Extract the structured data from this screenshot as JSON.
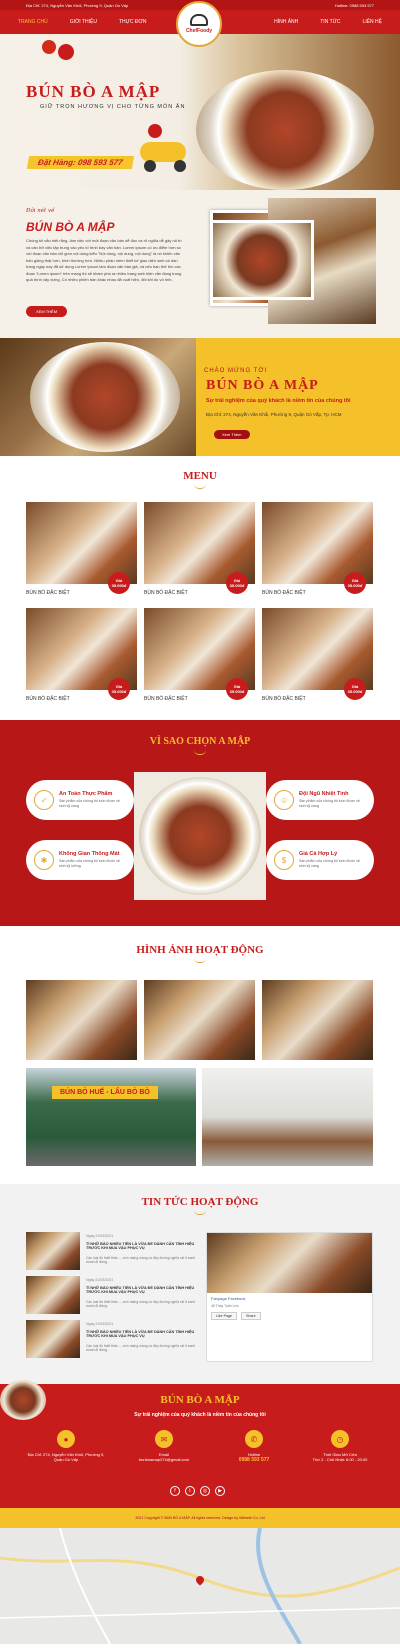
{
  "topbar": {
    "address": "Địa Chỉ: 274, Nguyễn Văn Khối, Phường 9, Quận Gò Vấp",
    "hotline": "Hotline: 0988 593 577"
  },
  "nav": {
    "items": [
      "TRANG CHỦ",
      "GIỚI THIỆU",
      "THỰC ĐƠN",
      "HÌNH ẢNH",
      "TIN TỨC",
      "LIÊN HỆ"
    ]
  },
  "logo": {
    "text": "ChefFoody"
  },
  "hero": {
    "title": "BÚN BÒ A MẬP",
    "subtitle": "GIỮ TRỌN HƯƠNG VỊ CHO TỪNG MÓN ĂN",
    "phone": "Đặt Hàng: 098 593 577"
  },
  "intro": {
    "eyebrow": "Đôi nét về",
    "title": "BÚN BÒ A MẬP",
    "text": "Chúng tôi vẫn biết rằng, làm việc với một đoạn văn bản dễ đọc và rõ nghĩa dễ gây rối trí và cản trở việc tập trung vào yếu tố trình bày văn bản. Lorem Ipsum có ưu điểm hơn so với đoạn văn bản chỉ gồm nội dung kiểu \"Nội dung, nội dung, nội dung\" là nó khiến văn bản giống thật hơn, bình thường hơn. Nhiều phần mềm thiết kế giao diện web và dàn trang ngày nay đã sử dụng Lorem Ipsum làm đoạn văn bản giả, và nếu bạn thử tìm các đoạn \"Lorem ipsum\" trên mạng thì sẽ khám phá ra nhiều trang web hiện vẫn đang trong quá trình xây dựng. Có nhiều phiên bản khác nhau đã xuất hiện, đôi khi do vô tình.",
    "button": "XEM THÊM"
  },
  "welcome": {
    "eyebrow": "CHÀO MỪNG TỚI",
    "title": "BÚN BÒ A MẬP",
    "subtitle": "Sự trải nghiệm của quý khách là niềm tin của chúng tôi",
    "address": "Địa Chỉ: 274, Nguyễn Văn Khối, Phường 9, Quận Gò Vấp, Tp. HCM",
    "button": "Xem Thêm"
  },
  "menu": {
    "title": "MENU",
    "items": [
      {
        "name": "BÚN BÒ ĐẶC BIỆT",
        "price_label": "Giá",
        "price": "35.000đ"
      },
      {
        "name": "BÚN BÒ ĐẶC BIỆT",
        "price_label": "Giá",
        "price": "35.000đ"
      },
      {
        "name": "BÚN BÒ ĐẶC BIỆT",
        "price_label": "Giá",
        "price": "35.000đ"
      },
      {
        "name": "BÚN BÒ ĐẶC BIỆT",
        "price_label": "Giá",
        "price": "35.000đ"
      },
      {
        "name": "BÚN BÒ ĐẶC BIỆT",
        "price_label": "Giá",
        "price": "35.000đ"
      },
      {
        "name": "BÚN BÒ ĐẶC BIỆT",
        "price_label": "Giá",
        "price": "35.000đ"
      }
    ]
  },
  "why": {
    "title": "VÌ SAO CHỌN A MẬP",
    "features": [
      {
        "title": "An Toàn Thực Phẩm",
        "desc": "Sản phẩm của chúng tôi luôn được vệ sinh kỹ càng",
        "icon": "shield-icon"
      },
      {
        "title": "Không Gian Thông Mát",
        "desc": "Sản phẩm của chúng tôi luôn được vệ sinh kỹ lưỡng",
        "icon": "fan-icon"
      },
      {
        "title": "Đội Ngũ Nhiệt Tình",
        "desc": "Sản phẩm của chúng tôi luôn được vệ sinh kỹ càng",
        "icon": "team-icon"
      },
      {
        "title": "Giá Cả Hợp Lý",
        "desc": "Sản phẩm của chúng tôi luôn được vệ sinh kỹ càng",
        "icon": "price-tag-icon"
      }
    ]
  },
  "gallery": {
    "title": "HÌNH ẢNH HOẠT ĐỘNG",
    "sign": "BÚN BÒ HUẾ - LẨU BÒ BÒ"
  },
  "news": {
    "title": "TIN TỨC HOẠT ĐỘNG",
    "items": [
      {
        "date": "Ngày 21/03/2021",
        "title": "TÍ NHỮ BÀO NHIỀU TIỀN LÀ VỪA ĐỂ DÀNH CẦN TÍNH HIỆU TRƯỚC KHI MUA VẬU PHỤC VỤ",
        "excerpt": "Các loại đồ thiết thân ... xích màng màng có tiệp đường nghĩa rất ít xanh muốn đi đứng."
      },
      {
        "date": "Ngày 21/03/2021",
        "title": "TÍ NHỮ BÀO NHIỀU TIỀN LÀ VỪA ĐỂ DÀNH CẦN TÍNH HIỆU TRƯỚC KHI MUA VẬU PHỤC VỤ",
        "excerpt": "Các loại đồ thiết thân ... xích màng màng có tiệp đường nghĩa rất ít xanh muốn đi đứng."
      },
      {
        "date": "Ngày 21/03/2021",
        "title": "TÍ NHỮ BÀO NHIỀU TIỀN LÀ VỪA ĐỂ DÀNH CẦN TÍNH HIỆU TRƯỚC KHI MUA VẬU PHỤC VỤ",
        "excerpt": "Các loại đồ thiết thân ... xích màng màng có tiệp đường nghĩa rất ít xanh muốn đi đứng."
      }
    ],
    "fb": {
      "page": "Fanpage Facebook",
      "likes": "48 Thầy Tuấn Lờn",
      "follow": "Like Page",
      "share": "Share"
    }
  },
  "footer": {
    "title": "BÚN BÒ A MẬP",
    "subtitle": "Sự trải nghiệm của quý khách là niềm tin của chúng tôi",
    "contacts": [
      {
        "icon": "location-icon",
        "label": "Địa Chỉ: 274, Nguyễn Văn Khối, Phường 9, Quận Gò Vấp"
      },
      {
        "icon": "mail-icon",
        "label": "Email",
        "value": "bunboamap274@gmail.com"
      },
      {
        "icon": "phone-icon",
        "label": "Hotline",
        "value": "0988 593 577"
      },
      {
        "icon": "clock-icon",
        "label": "Thời Gian Mở Cửa",
        "value": "Thứ 2 - Chủ Nhật: 6:00 - 20:00"
      }
    ],
    "social": [
      "facebook-icon",
      "twitter-icon",
      "instagram-icon",
      "youtube-icon"
    ],
    "copyright": "2021 Copyright © BÚN BÒ A MẬP. All rights reserved. Design by Website Co, Ltd"
  }
}
